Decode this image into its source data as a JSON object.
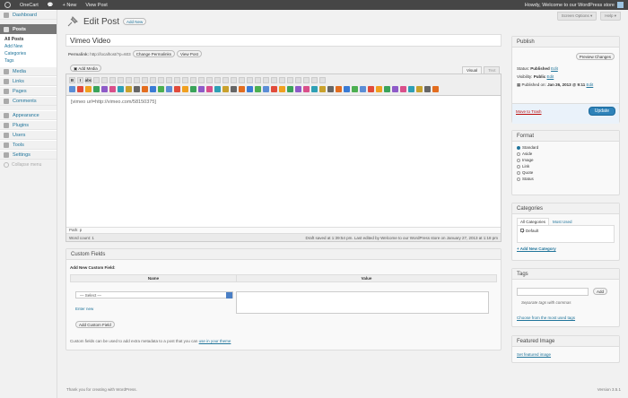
{
  "admin_bar": {
    "site": "OneCart",
    "new": "New",
    "view_post": "View Post",
    "howdy": "Howdy, Welcome to our WordPress store"
  },
  "screen_tabs": {
    "screen_options": "Screen Options ▾",
    "help": "Help ▾"
  },
  "menu": {
    "dashboard": "Dashboard",
    "posts": "Posts",
    "posts_sub": [
      "All Posts",
      "Add New",
      "Categories",
      "Tags"
    ],
    "items": [
      "Media",
      "Links",
      "Pages",
      "Comments"
    ],
    "items2": [
      "Appearance",
      "Plugins",
      "Users",
      "Tools",
      "Settings"
    ],
    "collapse": "Collapse menu"
  },
  "header": {
    "title": "Edit Post",
    "add_new": "Add New"
  },
  "post": {
    "title": "Vimeo Video",
    "permalink_label": "Permalink:",
    "permalink_url": "http://localhost/?p=603",
    "change_permalinks": "Change Permalinks",
    "view_post": "View Post",
    "add_media": "Add Media",
    "tab_visual": "Visual",
    "tab_text": "Text",
    "content": "[vimeo url=http://vimeo.com/58150375]",
    "path": "Path: p",
    "word_count": "Word count: 1",
    "draft_saved": "Draft saved at 1:39:54 pm. Last edited by Welcome to our WordPress store on January 27, 2013 at 1:18 pm"
  },
  "toolbar": {
    "row1_labels": [
      "B",
      "I",
      "abc"
    ]
  },
  "custom_fields": {
    "title": "Custom Fields",
    "add_new_label": "Add New Custom Field:",
    "col_name": "Name",
    "col_value": "Value",
    "select_placeholder": "— Select —",
    "enter_new": "Enter new",
    "add_button": "Add Custom Field",
    "help_prefix": "Custom fields can be used to add extra metadata to a post that you can ",
    "help_link": "use in your theme"
  },
  "publish": {
    "title": "Publish",
    "preview": "Preview Changes",
    "status_label": "Status:",
    "status_value": "Published",
    "visibility_label": "Visibility:",
    "visibility_value": "Public",
    "published_label": "Published on:",
    "published_value": "Jan 26, 2013 @ 9:11",
    "edit": "Edit",
    "trash": "Move to Trash",
    "update": "Update"
  },
  "format": {
    "title": "Format",
    "options": [
      "Standard",
      "Aside",
      "Image",
      "Link",
      "Quote",
      "Status"
    ],
    "selected": 0
  },
  "categories": {
    "title": "Categories",
    "tab_all": "All Categories",
    "tab_most": "Most Used",
    "items": [
      "Default"
    ],
    "add_new": "+ Add New Category"
  },
  "tags": {
    "title": "Tags",
    "add": "Add",
    "separate": "Separate tags with commas",
    "most": "Choose from the most used tags"
  },
  "featured": {
    "title": "Featured Image",
    "link": "Set featured image"
  },
  "footer": {
    "thanks": "Thank you for creating with WordPress.",
    "version": "Version 3.5.1"
  },
  "colors": {
    "link": "#21759b",
    "adminbar": "#464646",
    "update": "#2e82b9",
    "trash": "#bc0b0b"
  }
}
